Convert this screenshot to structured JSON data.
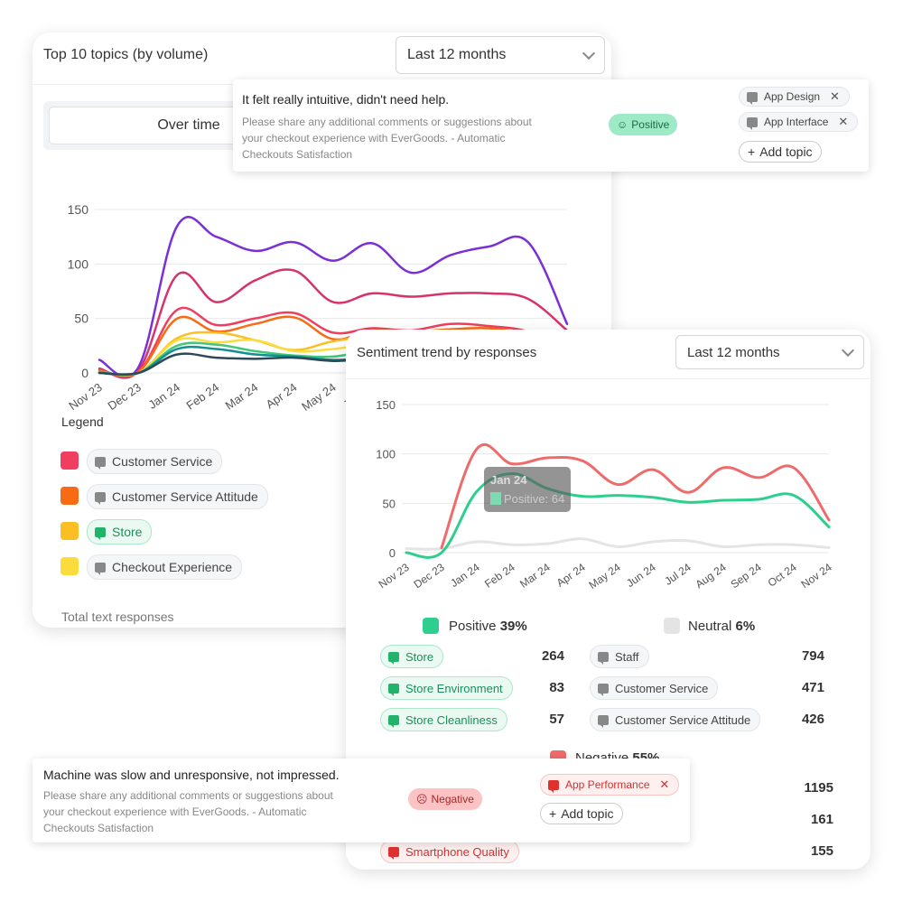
{
  "topics_card": {
    "title": "Top 10 topics (by volume)",
    "range": "Last 12 months",
    "view_tab": "Over time",
    "legend_title": "Legend",
    "legend": [
      {
        "label": "Customer Service",
        "color": "#f03e5e",
        "kind": "gray"
      },
      {
        "label": "Customer Service Attitude",
        "color": "#f76b15",
        "kind": "gray"
      },
      {
        "label": "Store",
        "color": "#fbbf24",
        "kind": "green"
      },
      {
        "label": "Checkout Experience",
        "color": "#fcdc3c",
        "kind": "gray"
      }
    ],
    "footer": "Total text responses"
  },
  "chart_data": [
    {
      "type": "line",
      "title": "Top 10 topics (by volume)",
      "categories": [
        "Nov 23",
        "Dec 23",
        "Jan 24",
        "Feb 24",
        "Mar 24",
        "Apr 24",
        "May 24",
        "Jun 24",
        "Jul 24",
        "Aug 24",
        "Sep 24",
        "Oct 24",
        "Nov 24"
      ],
      "ylim": [
        0,
        150
      ],
      "yticks": [
        0,
        50,
        100,
        150
      ],
      "grid": true,
      "series": [
        {
          "color": "#7b2fd6",
          "values": [
            12,
            5,
            135,
            125,
            112,
            120,
            103,
            119,
            92,
            108,
            116,
            120,
            45
          ]
        },
        {
          "color": "#d6336c",
          "values": [
            4,
            2,
            90,
            65,
            85,
            94,
            65,
            73,
            70,
            73,
            73,
            68,
            39
          ]
        },
        {
          "name": "Customer Service",
          "color": "#f03e5e",
          "values": [
            3,
            1,
            58,
            44,
            50,
            55,
            37,
            41,
            39,
            45,
            43,
            38,
            22
          ]
        },
        {
          "name": "Customer Service Attitude",
          "color": "#f76b15",
          "values": [
            2,
            1,
            50,
            38,
            45,
            51,
            31,
            39,
            38,
            40,
            41,
            35,
            20
          ]
        },
        {
          "name": "Store",
          "color": "#fbbf24",
          "values": [
            1,
            0,
            32,
            37,
            30,
            21,
            29,
            32,
            19,
            30,
            17,
            31,
            14
          ]
        },
        {
          "name": "Checkout Experience",
          "color": "#fcdc3c",
          "values": [
            1,
            0,
            30,
            28,
            30,
            20,
            22,
            25,
            14,
            24,
            17,
            25,
            12
          ]
        },
        {
          "color": "#40c77a",
          "values": [
            1,
            0,
            25,
            26,
            20,
            16,
            15,
            20,
            14,
            18,
            14,
            20,
            10
          ]
        },
        {
          "color": "#148f8f",
          "values": [
            0,
            0,
            22,
            22,
            17,
            15,
            12,
            14,
            12,
            16,
            13,
            18,
            8
          ]
        },
        {
          "color": "#2f4858",
          "values": [
            0,
            0,
            17,
            14,
            13,
            14,
            11,
            13,
            12,
            12,
            13,
            14,
            7
          ]
        }
      ]
    },
    {
      "type": "line",
      "title": "Sentiment trend by responses",
      "categories": [
        "Nov 23",
        "Dec 23",
        "Jan 24",
        "Feb 24",
        "Mar 24",
        "Apr 24",
        "May 24",
        "Jun 24",
        "Jul 24",
        "Aug 24",
        "Sep 24",
        "Oct 24",
        "Nov 24"
      ],
      "ylim": [
        0,
        150
      ],
      "yticks": [
        0,
        50,
        100,
        150
      ],
      "grid": true,
      "series": [
        {
          "name": "Neutral",
          "color": "#e4e4e4",
          "values": [
            4,
            4,
            11,
            8,
            9,
            14,
            6,
            11,
            12,
            6,
            8,
            8,
            5
          ]
        },
        {
          "name": "Negative",
          "color": "#ef6b6b",
          "values": [
            null,
            5,
            105,
            90,
            96,
            93,
            69,
            84,
            61,
            86,
            76,
            86,
            33
          ]
        },
        {
          "name": "Positive",
          "color": "#2ecf8e",
          "values": [
            0,
            0,
            62,
            80,
            65,
            57,
            58,
            56,
            51,
            53,
            54,
            58,
            26
          ]
        }
      ],
      "tooltip": {
        "title": "Jan 24",
        "label": "Positive: 64"
      }
    }
  ],
  "sentiment_card": {
    "title": "Sentiment trend by responses",
    "range": "Last 12 months",
    "positive": {
      "label": "Positive",
      "pct": "39%",
      "color": "#2ecf8e",
      "items": [
        {
          "label": "Store",
          "count": "264"
        },
        {
          "label": "Store Environment",
          "count": "83"
        },
        {
          "label": "Store Cleanliness",
          "count": "57"
        }
      ]
    },
    "neutral": {
      "label": "Neutral",
      "pct": "6%",
      "color": "#e4e4e4",
      "items": [
        {
          "label": "Staff",
          "count": "794"
        },
        {
          "label": "Customer Service",
          "count": "471"
        },
        {
          "label": "Customer Service Attitude",
          "count": "426"
        }
      ]
    },
    "negative": {
      "label": "Negative",
      "pct": "55%",
      "color": "#ef6b6b",
      "counts": [
        "1195",
        "161",
        "155"
      ],
      "visible_item": "Smartphone Quality"
    }
  },
  "response_positive": {
    "text": "It felt really intuitive, didn't need help.",
    "question": "Please share any additional comments or suggestions about your checkout experience with EverGoods. - Automatic Checkouts Satisfaction",
    "sentiment": "Positive",
    "topics": [
      "App Design",
      "App Interface"
    ],
    "add_topic": "Add topic"
  },
  "response_negative": {
    "text": "Machine was slow and unresponsive, not impressed.",
    "question": "Please share any additional comments or suggestions about your checkout experience with EverGoods. - Automatic Checkouts Satisfaction",
    "sentiment": "Negative",
    "topics": [
      "App Performance"
    ],
    "add_topic": "Add topic"
  }
}
